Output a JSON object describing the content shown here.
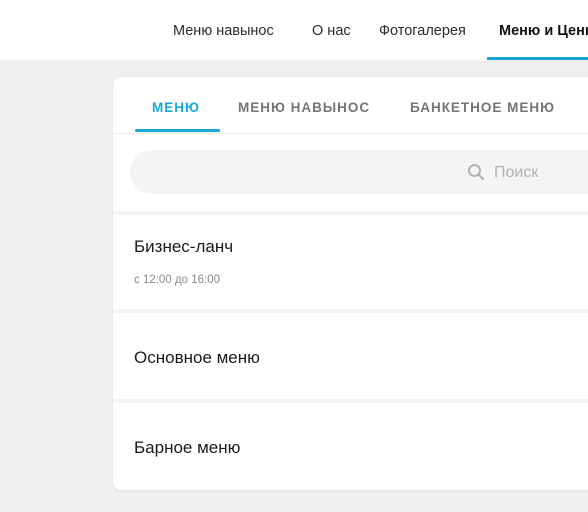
{
  "nav": {
    "items": [
      {
        "label": "Меню навынос"
      },
      {
        "label": "О нас"
      },
      {
        "label": "Фотогалерея"
      },
      {
        "label": "Меню и Цены"
      }
    ],
    "accent_color": "#18a8d8"
  },
  "tabs": [
    {
      "label": "МЕНЮ",
      "active": true
    },
    {
      "label": "МЕНЮ НАВЫНОС",
      "active": false
    },
    {
      "label": "БАНКЕТНОЕ МЕНЮ",
      "active": false
    }
  ],
  "search": {
    "placeholder": "Поиск",
    "icon": "search-icon"
  },
  "menus": [
    {
      "title": "Бизнес-ланч",
      "subtitle": "с 12:00 до 16:00"
    },
    {
      "title": "Основное меню"
    },
    {
      "title": "Барное меню"
    }
  ]
}
